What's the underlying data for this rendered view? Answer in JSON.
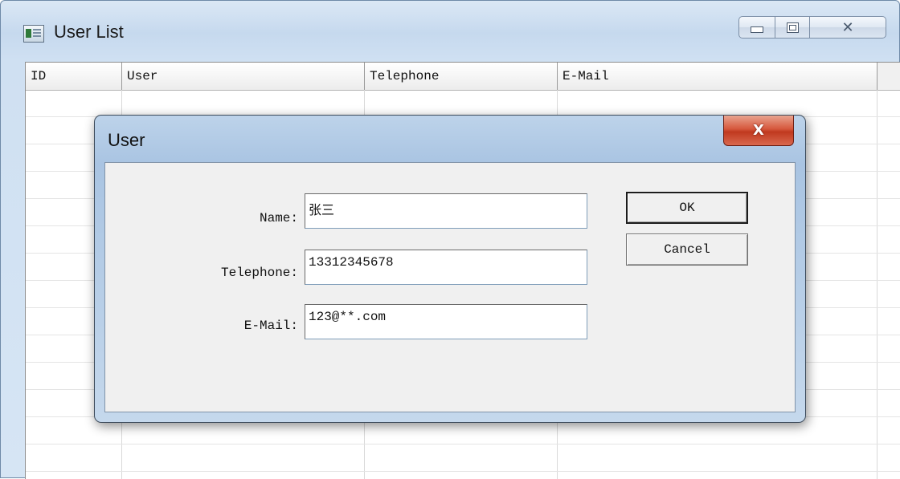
{
  "window": {
    "title": "User List",
    "icon": "app-window-icon",
    "controls": {
      "minimize": "minimize-icon",
      "maximize": "maximize-icon",
      "close": "✕"
    }
  },
  "list": {
    "columns": [
      "ID",
      "User",
      "Telephone",
      "E-Mail"
    ]
  },
  "dialog": {
    "title": "User",
    "close_glyph": "X",
    "fields": {
      "name": {
        "label": "Name:",
        "value": "张三"
      },
      "telephone": {
        "label": "Telephone:",
        "value": "13312345678"
      },
      "email": {
        "label": "E-Mail:",
        "value": "123@**.com"
      }
    },
    "buttons": {
      "ok": "OK",
      "cancel": "Cancel"
    }
  }
}
